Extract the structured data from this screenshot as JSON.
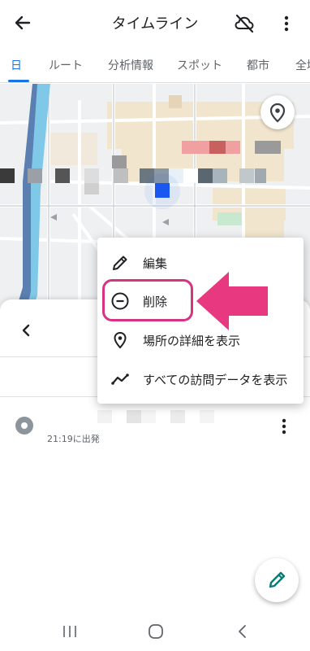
{
  "app_bar": {
    "title": "タイムライン",
    "back_icon": "arrow-left-icon",
    "cloud_icon": "cloud-off-icon",
    "more_icon": "more-vert-icon"
  },
  "tabs": [
    {
      "label": "日",
      "active": true
    },
    {
      "label": "ルート",
      "active": false
    },
    {
      "label": "分析情報",
      "active": false
    },
    {
      "label": "スポット",
      "active": false
    },
    {
      "label": "都市",
      "active": false
    },
    {
      "label": "全域",
      "active": false
    }
  ],
  "map": {
    "pin_button_icon": "location-pin-icon",
    "current_location_color": "#1a56f0"
  },
  "context_menu": {
    "items": [
      {
        "label": "編集",
        "icon": "pencil-icon"
      },
      {
        "label": "削除",
        "icon": "remove-circle-icon"
      },
      {
        "label": "場所の詳細を表示",
        "icon": "location-pin-icon"
      },
      {
        "label": "すべての訪問データを表示",
        "icon": "trend-line-icon"
      }
    ]
  },
  "timeline": {
    "visit_time": "21:19に出発",
    "visit_icon": "visit-dot-icon",
    "more_icon": "more-vert-icon"
  },
  "annotation": {
    "highlight_color": "#d63384",
    "arrow_color": "#e8387f"
  },
  "fab": {
    "icon": "pencil-icon",
    "color": "#0b7a75"
  },
  "nav_bar": {
    "recent_icon": "recent-apps-icon",
    "home_icon": "home-icon",
    "back_icon": "back-chevron-icon"
  }
}
